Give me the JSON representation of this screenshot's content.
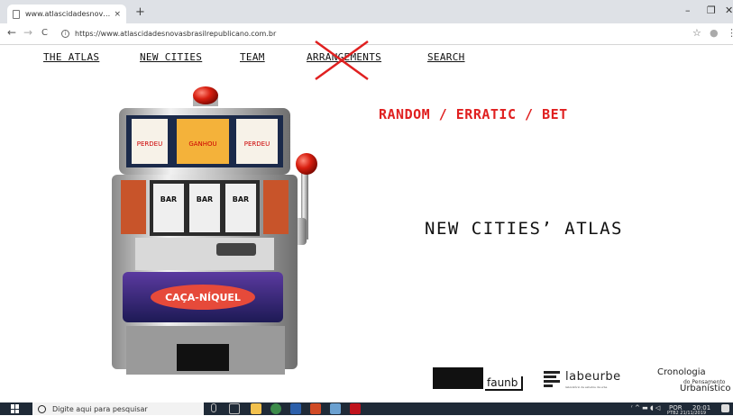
{
  "browser": {
    "tab_title": "www.atlascidadesnovasbrasilrep…",
    "tab_close": "×",
    "new_tab": "+",
    "url": "https://www.atlascidadesnovasbrasilrepublicano.com.br",
    "back": "←",
    "forward": "→",
    "reload": "C",
    "info": "i",
    "star": "☆",
    "profile": "●",
    "menu": "⋮",
    "minimize": "–",
    "maximize": "❐",
    "close": "✕"
  },
  "nav": {
    "atlas": "THE ATLAS",
    "new_cities": "NEW CITIES",
    "team": "TEAM",
    "arrangements": "ARRANGEMENTS",
    "search": "SEARCH"
  },
  "hero": {
    "tagline": "RANDOM / ERRATIC / BET",
    "title": "NEW CITIES’ ATLAS",
    "slot_reels_top": [
      "PERDEU",
      "GANHOU",
      "PERDEU"
    ],
    "slot_reels_mid": [
      "BAR",
      "BAR",
      "BAR"
    ],
    "slot_sign": "CAÇA-NÍQUEL"
  },
  "footer_logos": {
    "faunb": "faunb",
    "labeurbe": "labeurbe",
    "labeurbe_sub": "laboratório de estudos da urbe",
    "crono_1": "Cronologia",
    "crono_2": "do Pensamento",
    "crono_3": "Urbanístico"
  },
  "taskbar": {
    "search_placeholder": "Digite aqui para pesquisar",
    "lang": "POR",
    "time": "20:01",
    "date": "PTB2  21/11/2019"
  },
  "colors": {
    "accent_red": "#e02020",
    "chrome_bg": "#dee1e6",
    "taskbar_bg": "#1f2a37"
  }
}
